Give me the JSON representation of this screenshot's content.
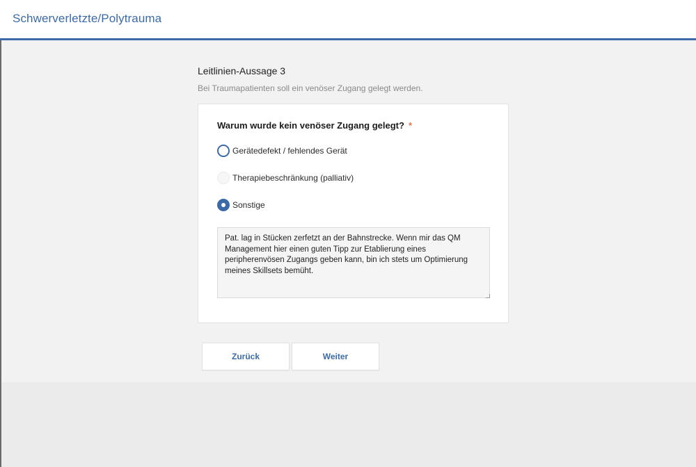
{
  "header": {
    "title": "Schwerverletzte/Polytrauma"
  },
  "statement": {
    "heading": "Leitlinien-Aussage 3",
    "text": "Bei Traumapatienten soll ein venöser Zugang gelegt werden."
  },
  "question": {
    "label": "Warum wurde kein venöser Zugang gelegt?",
    "required_marker": "*",
    "options": [
      {
        "label": "Gerätedefekt / fehlendes Gerät",
        "state": "unchecked"
      },
      {
        "label": "Therapiebeschränkung (palliativ)",
        "state": "disabled"
      },
      {
        "label": "Sonstige",
        "state": "checked"
      }
    ],
    "other_text": "Pat. lag in Stücken zerfetzt an der Bahnstrecke. Wenn mir das QM Management hier einen guten Tipp zur Etablierung eines peripherenvösen Zugangs geben kann, bin ich stets um Optimierung meines Skillsets bemüht."
  },
  "buttons": {
    "back_label": "Zurück",
    "next_label": "Weiter"
  },
  "colors": {
    "accent": "#3c6aa7",
    "required": "#e07a4f"
  }
}
